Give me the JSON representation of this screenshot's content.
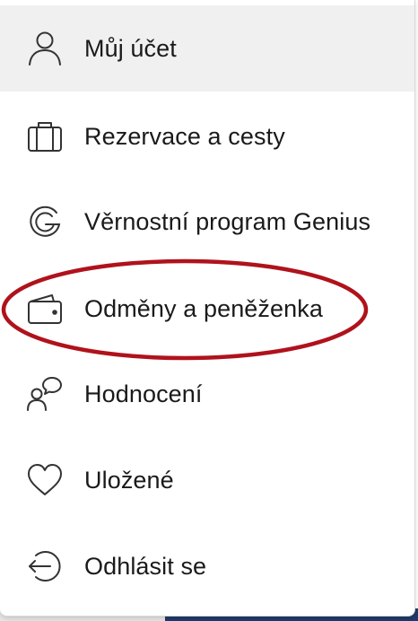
{
  "menu": {
    "items": [
      {
        "label": "Můj účet",
        "icon": "person-icon",
        "active": true
      },
      {
        "label": "Rezervace a cesty",
        "icon": "suitcase-icon",
        "active": false
      },
      {
        "label": "Věrnostní program Genius",
        "icon": "genius-g-icon",
        "active": false
      },
      {
        "label": "Odměny a peněženka",
        "icon": "wallet-icon",
        "active": false
      },
      {
        "label": "Hodnocení",
        "icon": "reviews-icon",
        "active": false
      },
      {
        "label": "Uložené",
        "icon": "heart-icon",
        "active": false
      },
      {
        "label": "Odhlásit se",
        "icon": "sign-out-icon",
        "active": false
      }
    ]
  },
  "annotation": {
    "highlight_color": "#b0121b",
    "highlighted_item": "Odměny a peněženka"
  },
  "colors": {
    "text": "#1a1a1a",
    "icon_stroke": "#333333",
    "active_background": "#f0f0f0"
  }
}
